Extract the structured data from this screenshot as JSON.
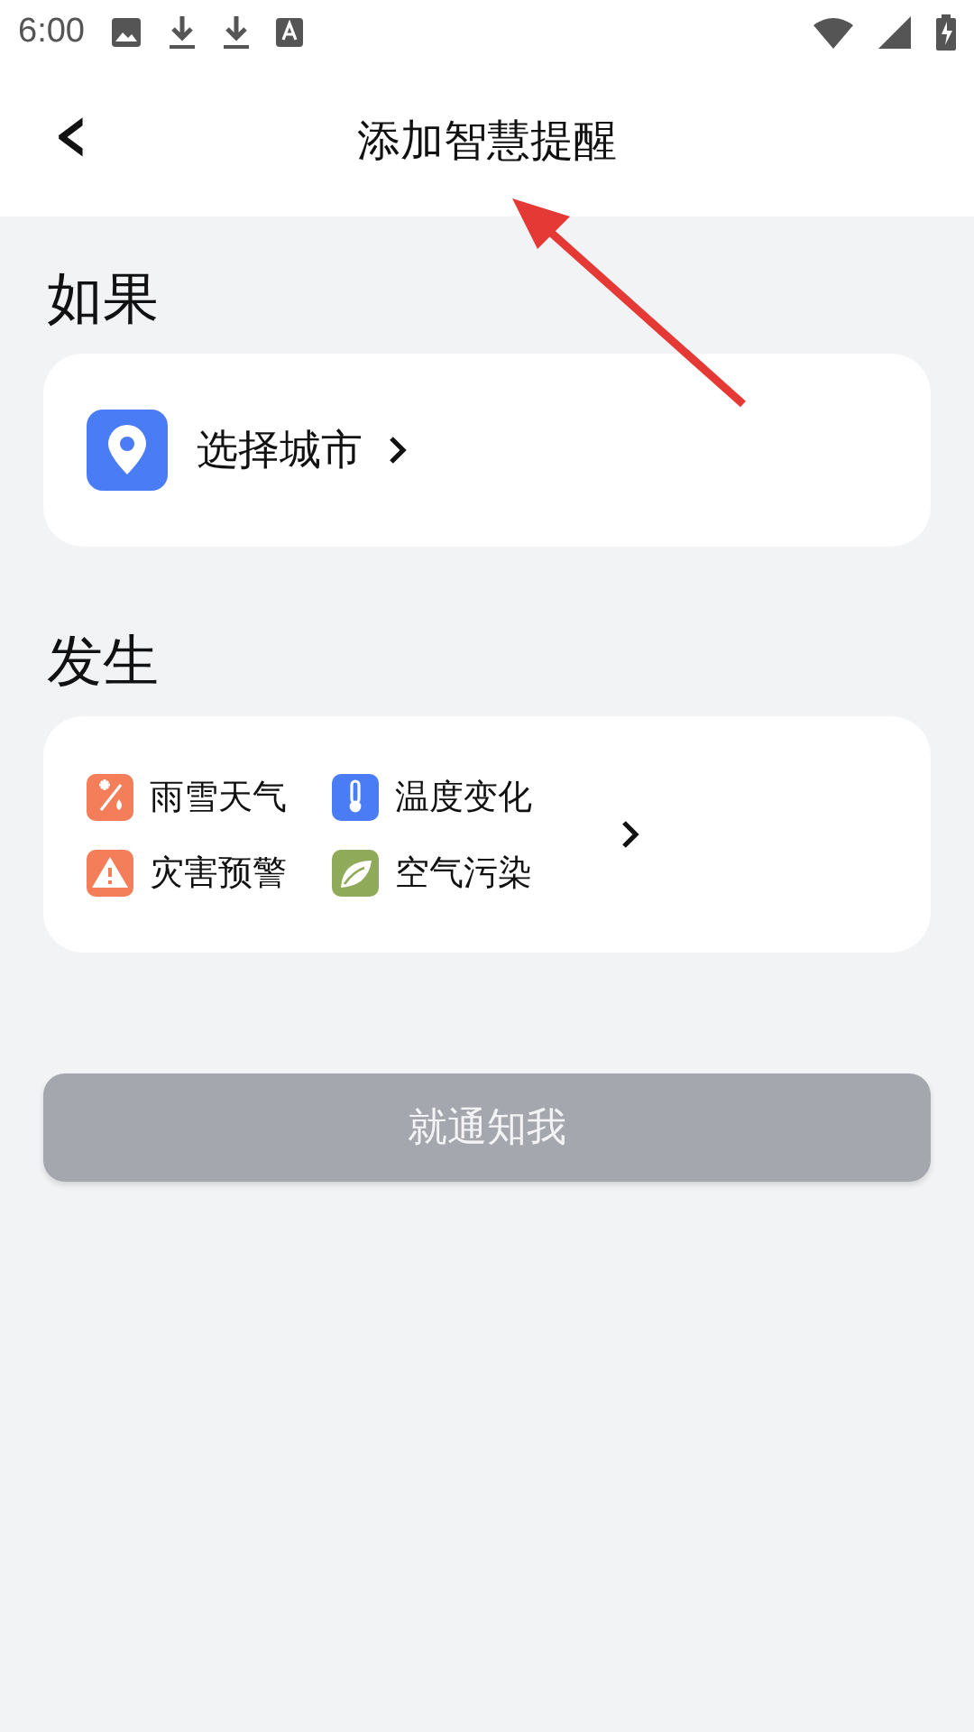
{
  "status_bar": {
    "time": "6:00"
  },
  "header": {
    "back": "‹",
    "title": "添加智慧提醒"
  },
  "condition": {
    "title": "如果",
    "city_label": "选择城市"
  },
  "events": {
    "title": "发生",
    "items": [
      {
        "label": "雨雪天气",
        "kind": "weather",
        "color": "#f47d5a"
      },
      {
        "label": "温度变化",
        "kind": "temperature",
        "color": "#4a7cf6"
      },
      {
        "label": "灾害预警",
        "kind": "warning",
        "color": "#f47d5a"
      },
      {
        "label": "空气污染",
        "kind": "air",
        "color": "#8fab5a"
      }
    ]
  },
  "submit": {
    "label": "就通知我",
    "disabled": true
  }
}
